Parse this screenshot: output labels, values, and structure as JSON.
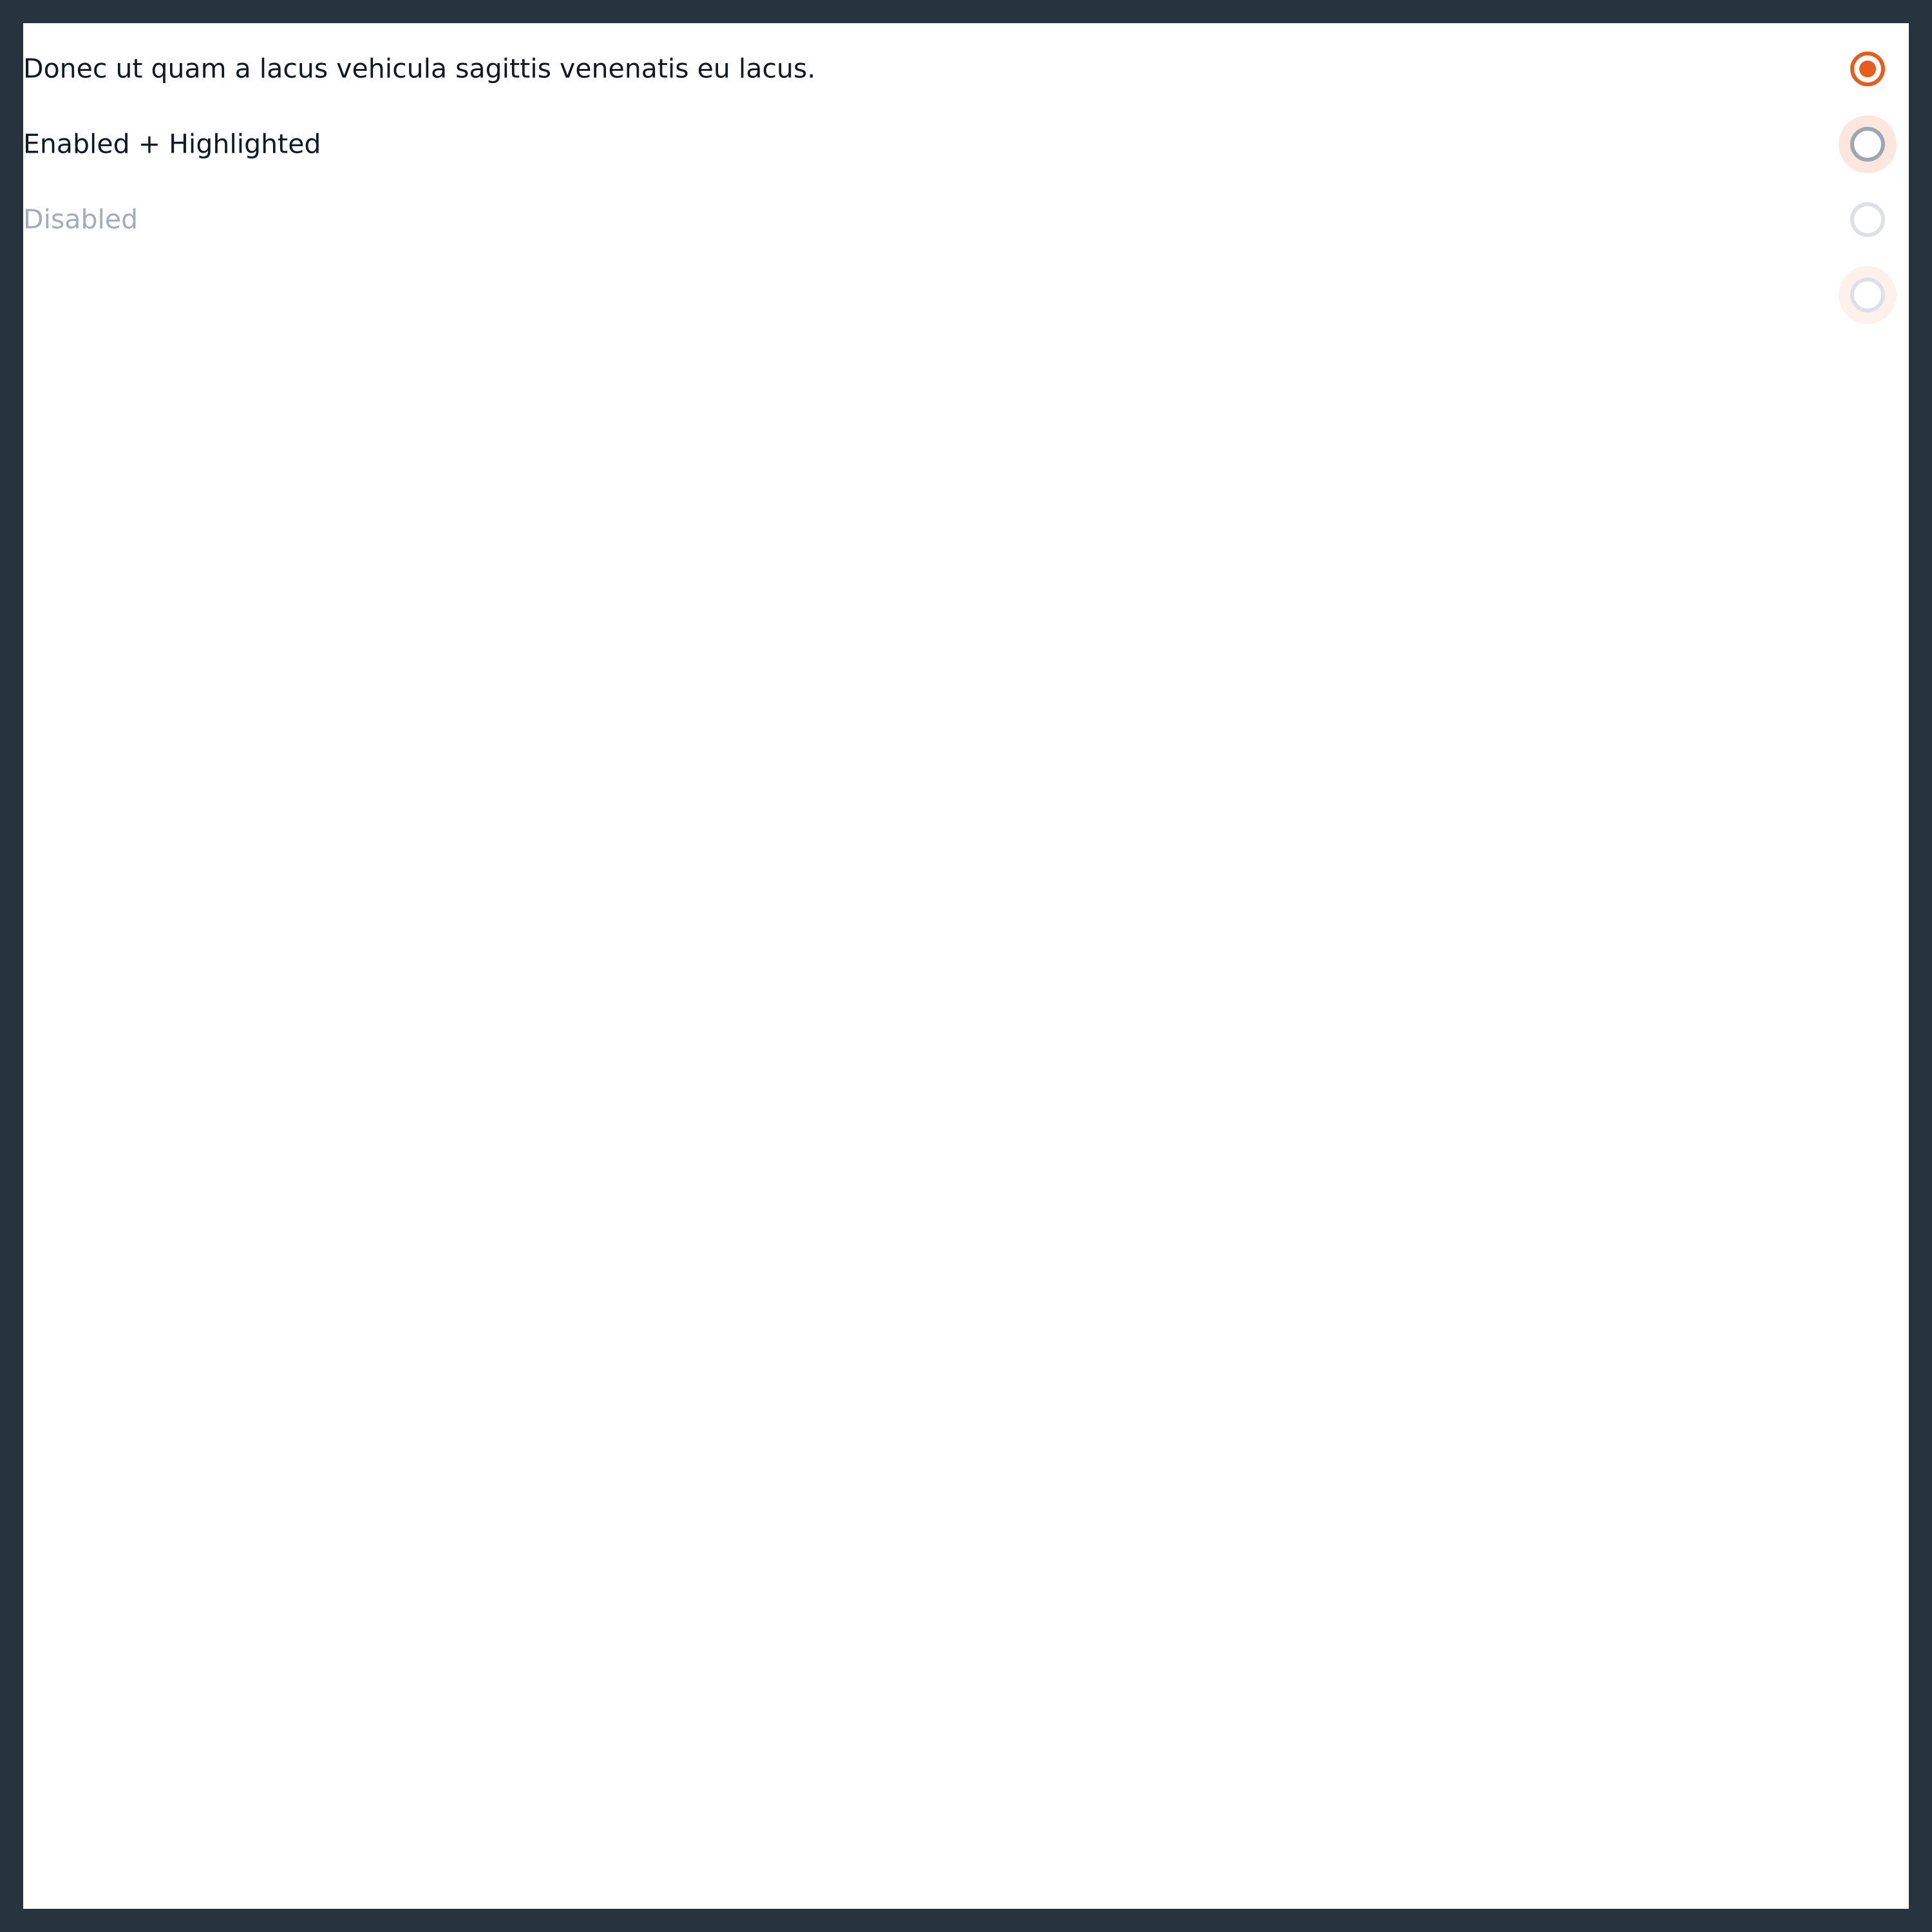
{
  "options": [
    {
      "label": "Donec ut quam a lacus vehicula sagittis venenatis eu lacus.",
      "state": "checked"
    },
    {
      "label": "Enabled + Highlighted",
      "state": "enabled-highlighted"
    },
    {
      "label": "Disabled",
      "state": "disabled"
    },
    {
      "label": "",
      "state": "disabled-highlighted"
    }
  ],
  "colors": {
    "frame": "#283340",
    "accent": "#e85d1e",
    "text": "#111a24",
    "text_disabled": "#a5abb7",
    "radio_border": "#9da6b2",
    "radio_border_disabled": "#dde1e7",
    "highlight": "#fde6de"
  }
}
